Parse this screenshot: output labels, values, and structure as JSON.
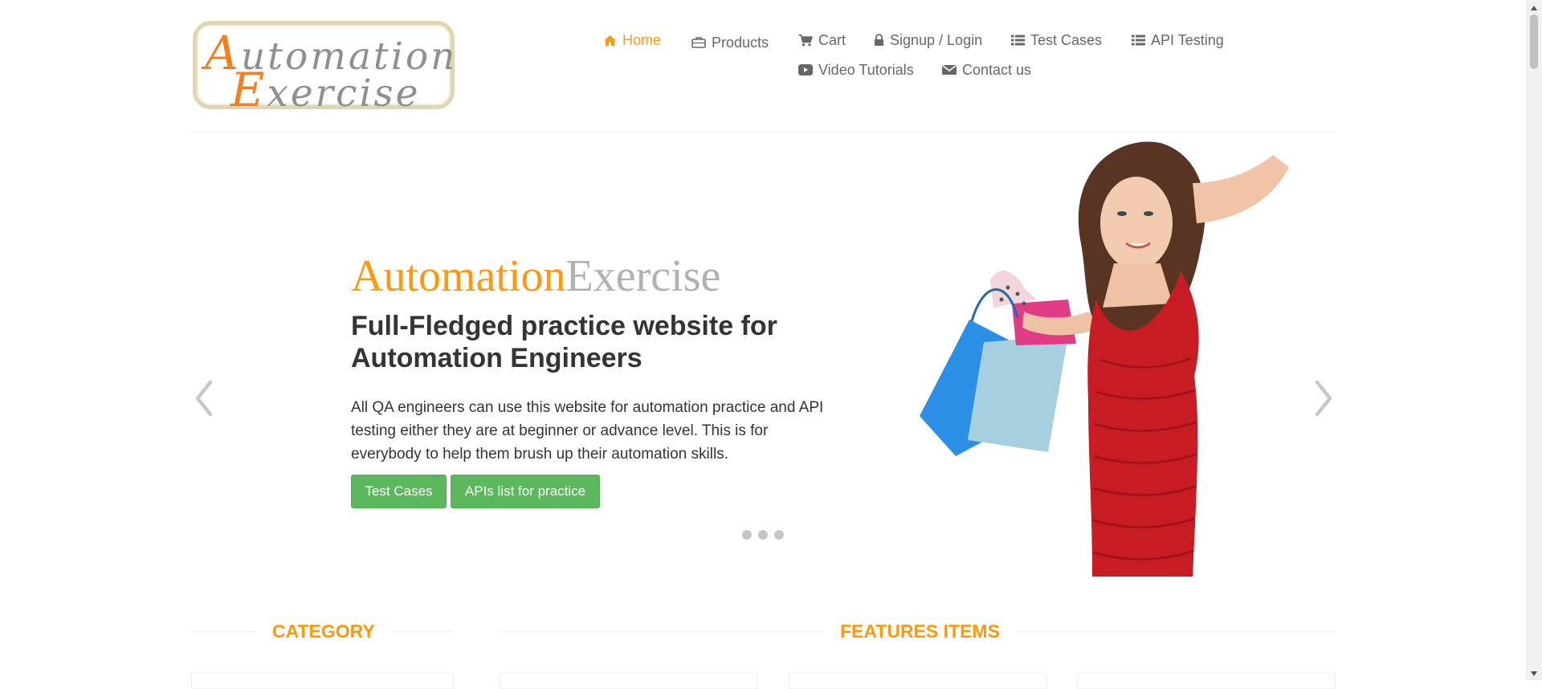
{
  "logo": {
    "line1_cap": "A",
    "line1_rest": "utomation",
    "line2_cap": "E",
    "line2_rest": "xercise"
  },
  "nav": {
    "home": "Home",
    "products": "Products",
    "cart": "Cart",
    "signup_login": "Signup / Login",
    "test_cases": "Test Cases",
    "api_testing": "API Testing",
    "video_tutorials": "Video Tutorials",
    "contact_us": "Contact us"
  },
  "slider": {
    "brand_part1": "Automation",
    "brand_part2": "Exercise",
    "headline": "Full-Fledged practice website for Automation Engineers",
    "description": "All QA engineers can use this website for automation practice and API testing either they are at beginner or advance level. This is for everybody to help them brush up their automation skills.",
    "button_test_cases": "Test Cases",
    "button_apis": "APIs list for practice",
    "indicator_count": 3
  },
  "sections": {
    "category": "CATEGORY",
    "features": "FEATURES ITEMS"
  },
  "colors": {
    "accent": "#fe980f",
    "button": "#5cb85c",
    "text_dark": "#363432",
    "text": "#696763"
  }
}
